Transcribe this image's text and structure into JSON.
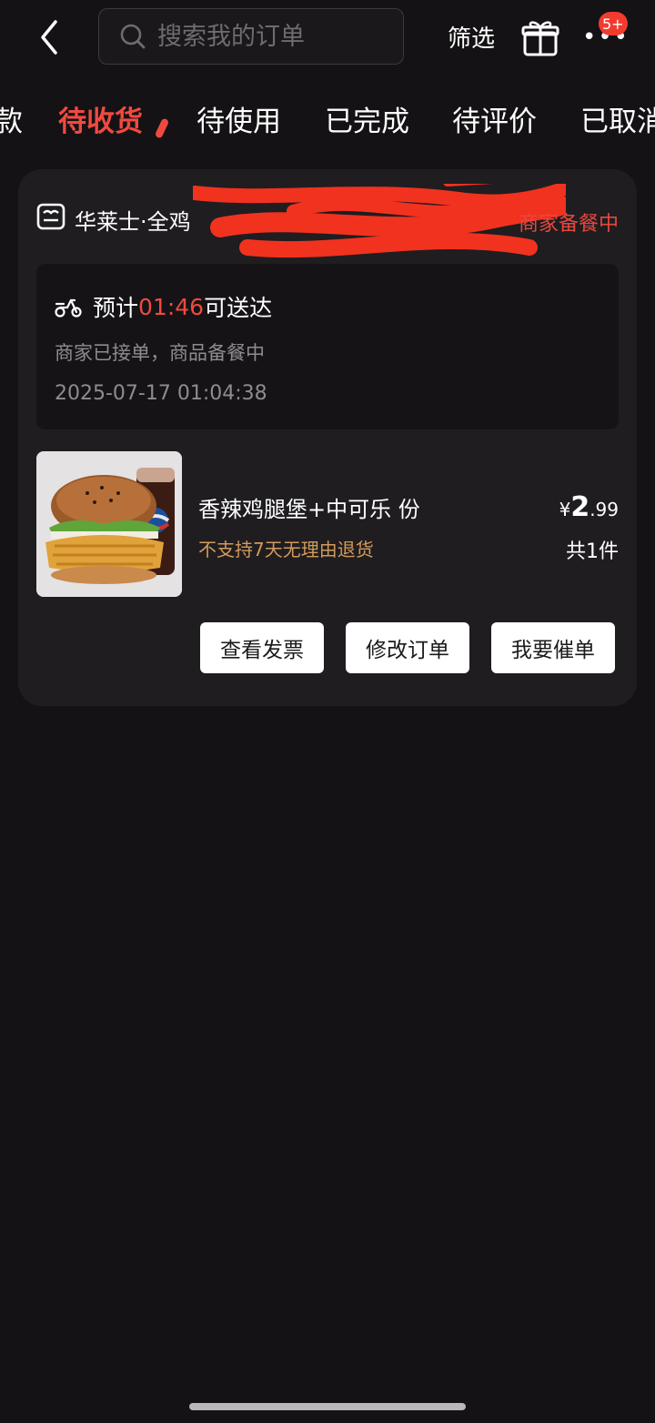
{
  "search": {
    "placeholder": "搜索我的订单"
  },
  "header": {
    "filter_label": "筛选",
    "badge": "5+"
  },
  "tabs": [
    {
      "label": "款"
    },
    {
      "label": "待收货"
    },
    {
      "label": "待使用"
    },
    {
      "label": "已完成"
    },
    {
      "label": "待评价"
    },
    {
      "label": "已取消"
    }
  ],
  "order": {
    "shop_name": "华莱士·全鸡",
    "status": "商家备餐中",
    "eta_prefix": "预计",
    "eta_time": "01:46",
    "eta_suffix": "可送达",
    "progress_text": "商家已接单，商品备餐中",
    "order_time": "2025-07-17 01:04:38",
    "product": {
      "name": "香辣鸡腿堡+中可乐 份",
      "return_policy": "不支持7天无理由退货",
      "price_currency": "¥",
      "price_int": "2",
      "price_dec": ".99",
      "quantity": "共1件"
    },
    "actions": [
      "查看发票",
      "修改订单",
      "我要催单"
    ]
  },
  "colors": {
    "accent": "#f04a40",
    "background": "#141214",
    "card": "#1f1d20",
    "warning": "#d29a5a"
  }
}
